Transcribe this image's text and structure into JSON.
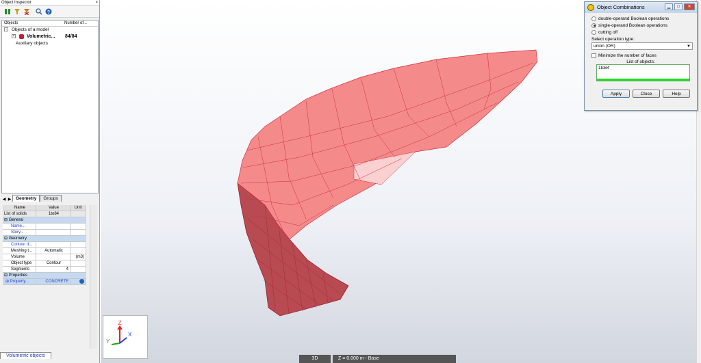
{
  "inspector": {
    "title": "Object Inspector",
    "close": "×",
    "tree_columns": [
      "Objects",
      "Number of..."
    ],
    "tree": [
      {
        "label": "Objects of a model",
        "count": ""
      },
      {
        "label": "Volumetric...",
        "count": "84/84"
      },
      {
        "label": "Auxiliary objects",
        "count": ""
      }
    ],
    "tabs": [
      "Geometry",
      "Groups"
    ],
    "properties": {
      "headers": [
        "Name",
        "Value",
        "Unit"
      ],
      "list_of_solids": {
        "name": "List of solids",
        "value": "1to84"
      },
      "general": "General",
      "name_row": "Name...",
      "story_row": "Story...",
      "geometry": "Geometry",
      "contour_row": "Contour d...",
      "meshing": {
        "name": "Meshing t...",
        "value": "Automatic"
      },
      "volume": {
        "name": "Volume",
        "unit": "(m3)"
      },
      "object_type": {
        "name": "Object type",
        "value": "Contour"
      },
      "segments": {
        "name": "Segments",
        "value": "4"
      },
      "properties_group": "Properties",
      "property": {
        "name": "Property...",
        "value": "CONCRETE"
      }
    },
    "bottom_tab": "Volumetric objects"
  },
  "viewport": {
    "axes": {
      "x": "X",
      "y": "Y",
      "z": "Z"
    },
    "status_mode": "3D",
    "status_level": "Z = 0.000 m - Base",
    "model_color": "#f58a8a"
  },
  "dialog": {
    "title": "Object Combinations",
    "options": [
      {
        "label": "double-operand Boolean operations",
        "selected": false
      },
      {
        "label": "single-operand Boolean operations",
        "selected": true
      },
      {
        "label": "cutting off",
        "selected": false
      }
    ],
    "select_label": "Select operation type:",
    "select_value": "union (OR)",
    "minimize_label": "Minimize the number of faces",
    "list_label": "List of objects:",
    "list_value": "1to84",
    "buttons": {
      "apply": "Apply",
      "close": "Close",
      "help": "Help"
    }
  }
}
